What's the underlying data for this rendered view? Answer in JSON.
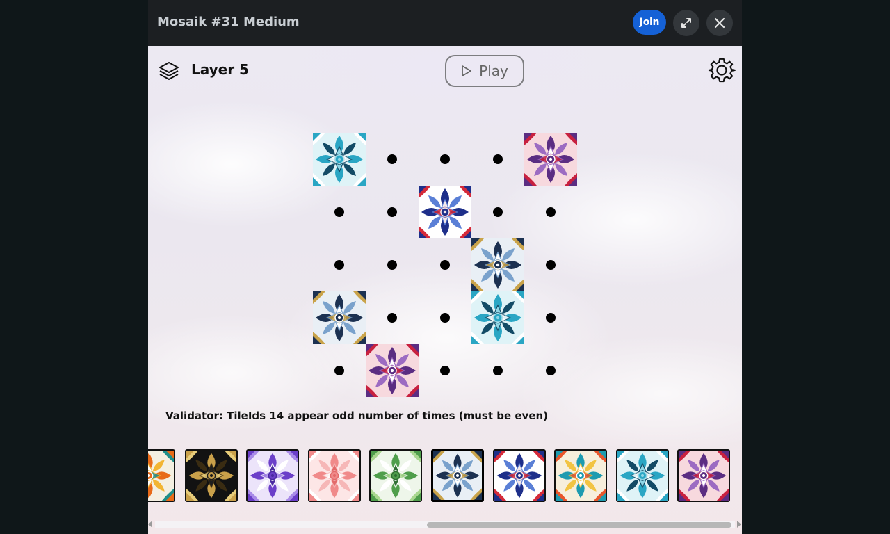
{
  "header": {
    "title": "Mosaik #31 Medium",
    "join_label": "Join",
    "expand_icon": "expand-icon",
    "close_icon": "close-icon"
  },
  "toolbar": {
    "layer_icon": "layers-icon",
    "layer_label": "Layer 5",
    "play_label": "Play",
    "settings_icon": "gear-icon"
  },
  "board": {
    "rows": 5,
    "cols": 5,
    "cells": [
      [
        "blue-star",
        "dot",
        "dot",
        "dot",
        "purple-flower"
      ],
      [
        "dot",
        "dot",
        "red-navy",
        "dot",
        "dot"
      ],
      [
        "dot",
        "dot",
        "dot",
        "navy-gold",
        "dot"
      ],
      [
        "navy-gold",
        "dot",
        "dot",
        "blue-star",
        "dot"
      ],
      [
        "dot",
        "purple-flower",
        "dot",
        "dot",
        "dot"
      ]
    ]
  },
  "validator": {
    "message": "Validator: TileIds 14 appear odd number of times (must be even)"
  },
  "palette": {
    "items": [
      {
        "tile": "orange-teal",
        "selected": false
      },
      {
        "tile": "gold-black",
        "selected": false
      },
      {
        "tile": "lavender",
        "selected": false
      },
      {
        "tile": "pink-petal",
        "selected": false
      },
      {
        "tile": "green-leaf",
        "selected": false
      },
      {
        "tile": "navy-gold",
        "selected": true
      },
      {
        "tile": "red-navy",
        "selected": false
      },
      {
        "tile": "teal-sun",
        "selected": false
      },
      {
        "tile": "blue-star",
        "selected": false
      },
      {
        "tile": "purple-flower",
        "selected": false
      }
    ]
  },
  "tile_styles": {
    "blue-star": {
      "bg": "#dff3f7",
      "a": "#2aa6c4",
      "b": "#ffffff",
      "c": "#134b66",
      "d": "#8fd6e6"
    },
    "purple-flower": {
      "bg": "#f7d9de",
      "a": "#5b2d82",
      "b": "#c8213f",
      "c": "#9c6bc2",
      "d": "#ffffff"
    },
    "red-navy": {
      "bg": "#ffffff",
      "a": "#1e2f8a",
      "b": "#d52b3a",
      "c": "#5a7fd6",
      "d": "#f3e8ea"
    },
    "navy-gold": {
      "bg": "#e9eff5",
      "a": "#1c3151",
      "b": "#c9a34a",
      "c": "#7aa2cc",
      "d": "#ffffff"
    },
    "orange-teal": {
      "bg": "#f4efe2",
      "a": "#e86a18",
      "b": "#1f8f8a",
      "c": "#f2b533",
      "d": "#ffffff"
    },
    "gold-black": {
      "bg": "#121212",
      "a": "#c9a04a",
      "b": "#e7cc7a",
      "c": "#3a2c12",
      "d": "#1e1e1e"
    },
    "lavender": {
      "bg": "#ece4fa",
      "a": "#6b3fc9",
      "b": "#a98be8",
      "c": "#ffffff",
      "d": "#4a2aa0"
    },
    "pink-petal": {
      "bg": "#fde6e6",
      "a": "#f08a8a",
      "b": "#ffffff",
      "c": "#f6b7b7",
      "d": "#e36a6a"
    },
    "green-leaf": {
      "bg": "#eef6ea",
      "a": "#4f9e4b",
      "b": "#a9d78f",
      "c": "#ffffff",
      "d": "#2f6e33"
    },
    "teal-sun": {
      "bg": "#f7efdc",
      "a": "#1e9bb0",
      "b": "#e8562b",
      "c": "#f2c443",
      "d": "#ffffff"
    }
  }
}
